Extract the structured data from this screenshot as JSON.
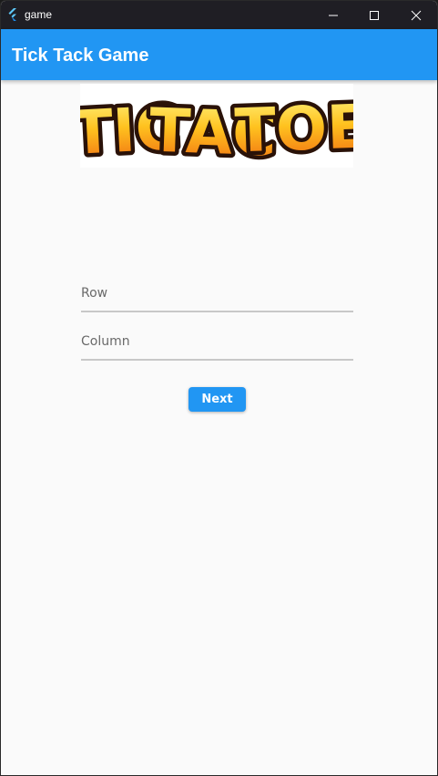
{
  "window": {
    "title": "game"
  },
  "appbar": {
    "title": "Tick Tack Game",
    "color": "#2196f3"
  },
  "logo": {
    "text_parts": [
      "TIC",
      "TAC",
      "TOE"
    ]
  },
  "form": {
    "row_placeholder": "Row",
    "column_placeholder": "Column",
    "row_value": "",
    "column_value": "",
    "next_label": "Next"
  },
  "icons": {
    "app": "flutter-logo-icon",
    "minimize": "minimize-icon",
    "maximize": "maximize-icon",
    "close": "close-icon"
  }
}
